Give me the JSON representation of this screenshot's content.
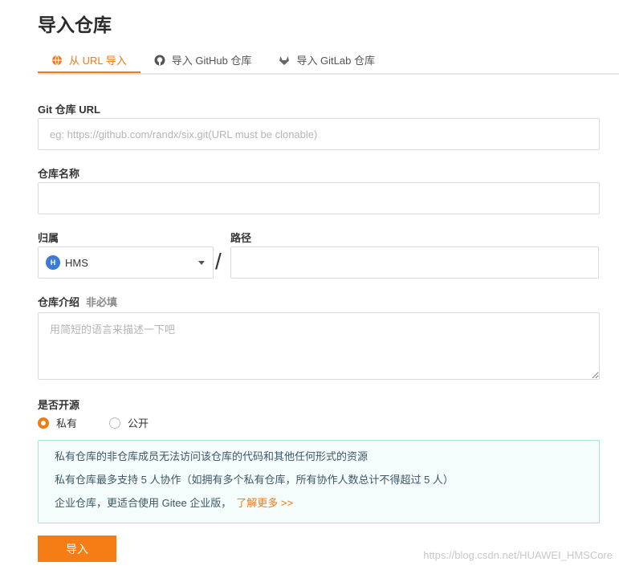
{
  "page": {
    "title": "导入仓库"
  },
  "tabs": [
    {
      "label": "从 URL 导入",
      "icon": "globe-icon",
      "active": true
    },
    {
      "label": "导入 GitHub 仓库",
      "icon": "github-icon",
      "active": false
    },
    {
      "label": "导入 GitLab 仓库",
      "icon": "gitlab-icon",
      "active": false
    }
  ],
  "form": {
    "git_url": {
      "label": "Git 仓库 URL",
      "placeholder": "eg: https://github.com/randx/six.git(URL must be clonable)",
      "value": ""
    },
    "repo_name": {
      "label": "仓库名称",
      "value": ""
    },
    "owner": {
      "label": "归属",
      "avatar_letter": "H",
      "value": "HMS"
    },
    "separator": "/",
    "path": {
      "label": "路径",
      "value": ""
    },
    "description": {
      "label": "仓库介绍",
      "optional": "非必填",
      "placeholder": "用简短的语言来描述一下吧"
    },
    "visibility": {
      "label": "是否开源",
      "options": [
        {
          "label": "私有",
          "checked": true
        },
        {
          "label": "公开",
          "checked": false
        }
      ]
    }
  },
  "notice": {
    "line1": "私有仓库的非仓库成员无法访问该仓库的代码和其他任何形式的资源",
    "line2": "私有仓库最多支持 5 人协作（如拥有多个私有仓库，所有协作人数总计不得超过 5 人）",
    "line3": "企业仓库，更适合使用 Gitee 企业版，",
    "learn_more": "了解更多 >>"
  },
  "submit_label": "导入",
  "watermark": "https://blog.csdn.net/HUAWEI_HMSCore",
  "colors": {
    "accent": "#f07a13",
    "notice_bg": "#f4fcfc",
    "notice_border": "#a9dedd"
  }
}
